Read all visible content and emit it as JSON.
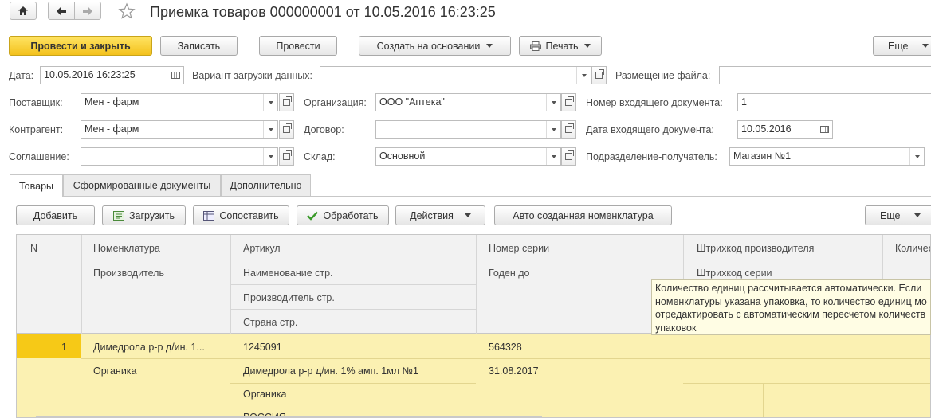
{
  "header": {
    "title": "Приемка товаров 000000001 от 10.05.2016 16:23:25"
  },
  "toolbar": {
    "post_close": "Провести и закрыть",
    "write": "Записать",
    "post": "Провести",
    "create_based": "Создать на основании",
    "print": "Печать",
    "more": "Еще"
  },
  "form": {
    "date_label": "Дата:",
    "date_value": "10.05.2016 16:23:25",
    "load_variant_label": "Вариант загрузки данных:",
    "load_variant_value": "",
    "file_location_label": "Размещение файла:",
    "file_location_value": "",
    "supplier_label": "Поставщик:",
    "supplier_value": "Мен - фарм",
    "organization_label": "Организация:",
    "organization_value": "ООО \"Аптека\"",
    "incoming_number_label": "Номер входящего документа:",
    "incoming_number_value": "1",
    "counterparty_label": "Контрагент:",
    "counterparty_value": "Мен - фарм",
    "contract_label": "Договор:",
    "contract_value": "",
    "incoming_date_label": "Дата входящего документа:",
    "incoming_date_value": "10.05.2016",
    "agreement_label": "Соглашение:",
    "agreement_value": "",
    "warehouse_label": "Склад:",
    "warehouse_value": "Основной",
    "receiver_label": "Подразделение-получатель:",
    "receiver_value": "Магазин №1"
  },
  "tabs": [
    {
      "label": "Товары",
      "active": true
    },
    {
      "label": "Сформированные документы",
      "active": false
    },
    {
      "label": "Дополнительно",
      "active": false
    }
  ],
  "table_toolbar": {
    "add": "Добавить",
    "load": "Загрузить",
    "match": "Сопоставить",
    "process": "Обработать",
    "actions": "Действия",
    "auto_nomenclature": "Авто созданная номенклатура",
    "more": "Еще"
  },
  "table": {
    "headers": {
      "n": "N",
      "nomenclature": "Номенклатура",
      "manufacturer": "Производитель",
      "article": "Артикул",
      "name_str": "Наименование стр.",
      "manufacturer_str": "Производитель стр.",
      "country_str": "Страна стр.",
      "series": "Номер серии",
      "valid_until": "Годен до",
      "barcode": "Штрихкод производителя",
      "series_barcode": "Штрихкод серии",
      "quantity": "Количество"
    },
    "rows": [
      {
        "n": "1",
        "nomenclature": "Димедрола р-р д/ин. 1...",
        "manufacturer": "Органика",
        "article": "1245091",
        "name_str": "Димедрола р-р д/ин. 1% амп. 1мл №1",
        "manufacturer_str": "Органика",
        "country_str": "РОССИЯ",
        "series": "564328",
        "valid_until": "31.08.2017"
      }
    ]
  },
  "tooltip": {
    "line1": "Количество единиц рассчитывается автоматически. Если",
    "line2": "номенклатуры указана упаковка, то количество единиц мо",
    "line3": "отредактировать с автоматическим пересчетом количеств",
    "line4": "упаковок"
  },
  "colors": {
    "primary_button": "#f3c11c",
    "selected_row": "#fbf1b2",
    "selected_cell": "#f6c917",
    "tooltip_bg": "#fffde4"
  }
}
